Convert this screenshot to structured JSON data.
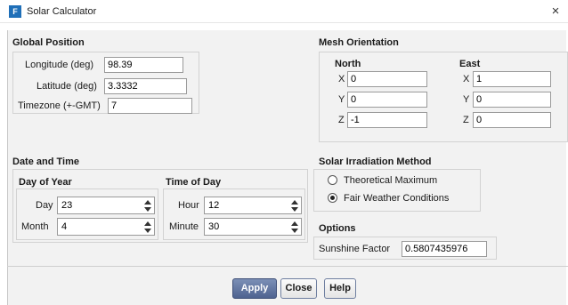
{
  "window": {
    "title": "Solar Calculator",
    "icon_letter": "F",
    "close_glyph": "×"
  },
  "global_position": {
    "title": "Global Position",
    "longitude_label": "Longitude (deg)",
    "longitude_value": "98.39",
    "latitude_label": "Latitude (deg)",
    "latitude_value": "3.3332",
    "timezone_label": "Timezone (+-GMT)",
    "timezone_value": "7"
  },
  "mesh_orientation": {
    "title": "Mesh Orientation",
    "north": {
      "title": "North",
      "x_label": "X",
      "x": "0",
      "y_label": "Y",
      "y": "0",
      "z_label": "Z",
      "z": "-1"
    },
    "east": {
      "title": "East",
      "x_label": "X",
      "x": "1",
      "y_label": "Y",
      "y": "0",
      "z_label": "Z",
      "z": "0"
    }
  },
  "date_time": {
    "title": "Date and Time",
    "day_of_year": {
      "title": "Day of Year",
      "day_label": "Day",
      "day": "23",
      "month_label": "Month",
      "month": "4"
    },
    "time_of_day": {
      "title": "Time of Day",
      "hour_label": "Hour",
      "hour": "12",
      "minute_label": "Minute",
      "minute": "30"
    }
  },
  "irradiation": {
    "title": "Solar Irradiation Method",
    "option1": "Theoretical Maximum",
    "option2": "Fair Weather Conditions",
    "selected": "Fair Weather Conditions"
  },
  "options": {
    "title": "Options",
    "sunshine_label": "Sunshine Factor",
    "sunshine_value": "0.5807435976"
  },
  "buttons": {
    "apply": "Apply",
    "close": "Close",
    "help": "Help"
  }
}
